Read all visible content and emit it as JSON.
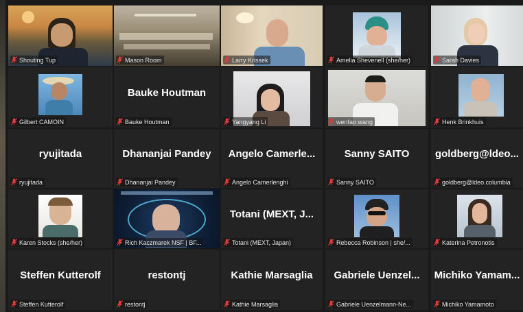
{
  "colors": {
    "active_speaker_border": "#c8e23f",
    "muted_icon": "#e03b3b",
    "tile_bg": "#232323"
  },
  "icons": {
    "muted": "microphone-muted-icon"
  },
  "tiles": [
    {
      "label": "Shouting Tup"
    },
    {
      "label": "Mason Room"
    },
    {
      "label": "Larry Krissek"
    },
    {
      "label": "Amelia Shevenell (she/her)"
    },
    {
      "label": "Sarah Davies"
    },
    {
      "label": "Gilbert CAMOIN"
    },
    {
      "name": "Bauke Houtman",
      "label": "Bauke Houtman"
    },
    {
      "label": "Yangyang Li"
    },
    {
      "label": "wenfao wang"
    },
    {
      "label": "Henk Brinkhuis"
    },
    {
      "name": "ryujitada",
      "label": "ryujitada"
    },
    {
      "name": "Dhananjai Pandey",
      "label": "Dhananjai Pandey"
    },
    {
      "name": "Angelo Camerle...",
      "label": "Angelo Camerlenghi"
    },
    {
      "name": "Sanny SAITO",
      "label": "Sanny SAITO"
    },
    {
      "name": "goldberg@ldeo...",
      "label": "goldberg@ldeo.columbia"
    },
    {
      "label": "Karen Stocks (she/her)"
    },
    {
      "label": "Rich Kaczmarek NSF | BF..."
    },
    {
      "name": "Totani (MEXT, J...",
      "label": "Totani (MEXT, Japan)"
    },
    {
      "label": "Rebecca Robinson | she/..."
    },
    {
      "label": "Katerina Petronotis"
    },
    {
      "name": "Steffen Kutterolf",
      "label": "Steffen Kutterolf"
    },
    {
      "name": "restontj",
      "label": "restontj"
    },
    {
      "name": "Kathie Marsaglia",
      "label": "Kathie Marsaglia"
    },
    {
      "name": "Gabriele Uenzel...",
      "label": "Gabriele Uenzelmann-Ne..."
    },
    {
      "name": "Michiko Yamam...",
      "label": "Michiko Yamamoto"
    }
  ]
}
